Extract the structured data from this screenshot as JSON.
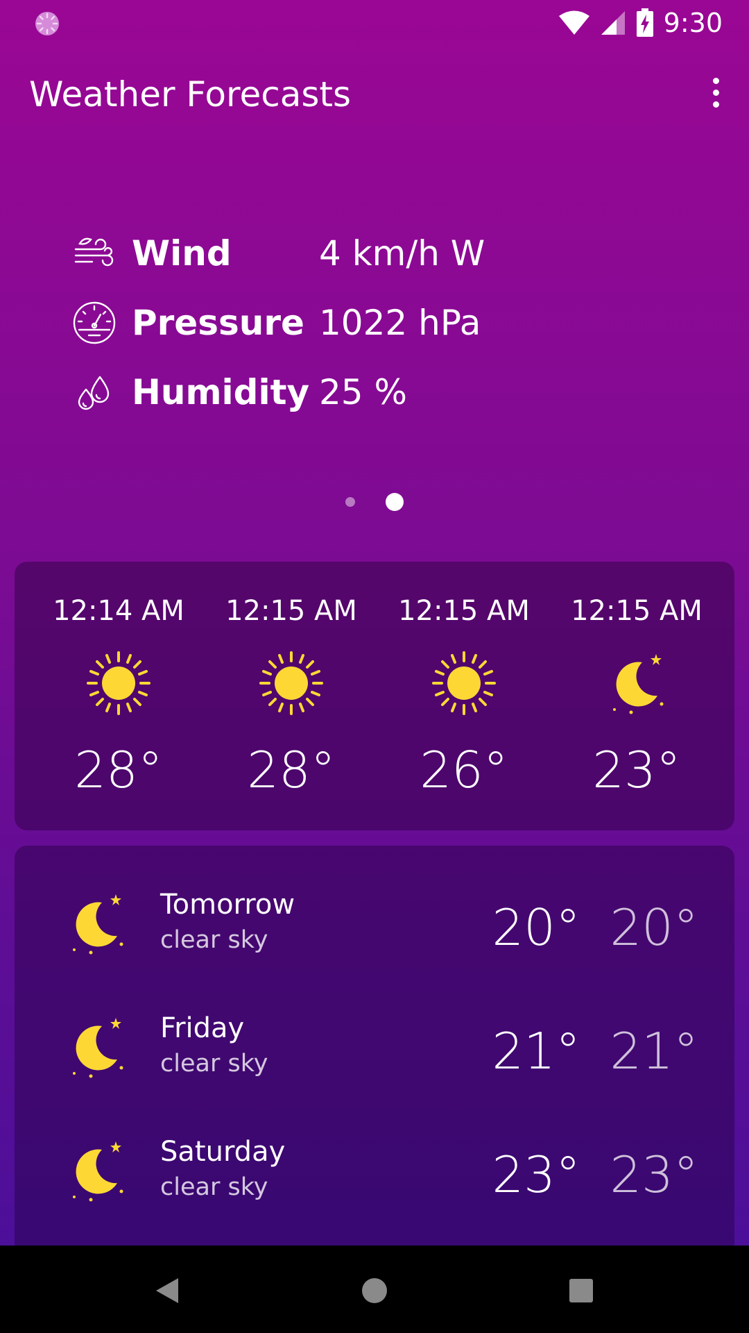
{
  "status_bar": {
    "time": "9:30",
    "icons": [
      "loading-circle-icon",
      "wifi-icon",
      "signal-icon",
      "battery-charging-icon"
    ]
  },
  "app_bar": {
    "title": "Weather Forecasts",
    "menu_icon": "more-vert-icon"
  },
  "details": [
    {
      "label": "Wind",
      "value": "4 km/h W",
      "icon": "wind-icon"
    },
    {
      "label": "Pressure",
      "value": "1022 hPa",
      "icon": "gauge-icon"
    },
    {
      "label": "Humidity",
      "value": "25 %",
      "icon": "droplets-icon"
    }
  ],
  "pager": {
    "pages": 2,
    "active_index": 1
  },
  "hourly": [
    {
      "time": "12:14 AM",
      "temp": "28°",
      "icon": "sun-icon"
    },
    {
      "time": "12:15 AM",
      "temp": "28°",
      "icon": "sun-icon"
    },
    {
      "time": "12:15 AM",
      "temp": "26°",
      "icon": "sun-icon"
    },
    {
      "time": "12:15 AM",
      "temp": "23°",
      "icon": "moon-icon"
    }
  ],
  "daily": [
    {
      "day": "Tomorrow",
      "description": "clear sky",
      "max": "20°",
      "min": "20°",
      "icon": "moon-icon"
    },
    {
      "day": "Friday",
      "description": "clear sky",
      "max": "21°",
      "min": "21°",
      "icon": "moon-icon"
    },
    {
      "day": "Saturday",
      "description": "clear sky",
      "max": "23°",
      "min": "23°",
      "icon": "moon-icon"
    }
  ],
  "nav_bar": {
    "icons": [
      "back-icon",
      "home-icon",
      "recents-icon"
    ]
  },
  "colors": {
    "gradient_top": "#9a0794",
    "gradient_bottom": "#47109a",
    "icon_yellow": "#fdd835",
    "card": "#3a0550"
  }
}
